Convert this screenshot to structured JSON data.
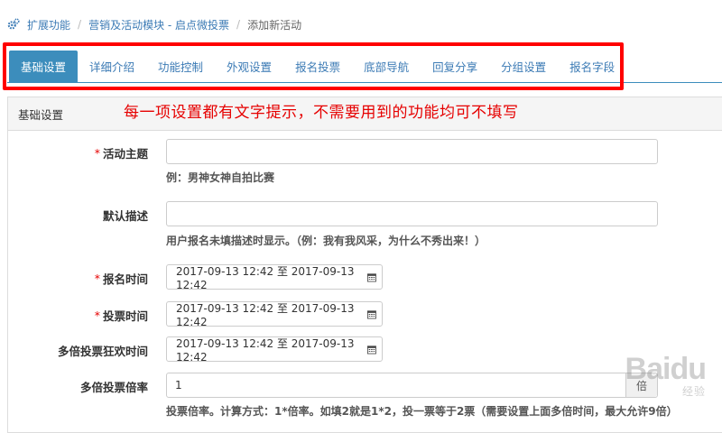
{
  "breadcrumb": {
    "items": [
      "扩展功能",
      "营销及活动模块 - 启点微投票",
      "添加新活动"
    ]
  },
  "tabs": [
    "基础设置",
    "详细介绍",
    "功能控制",
    "外观设置",
    "报名投票",
    "底部导航",
    "回复分享",
    "分组设置",
    "报名字段"
  ],
  "active_tab": "基础设置",
  "panel": {
    "title": "基础设置",
    "annotation": "每一项设置都有文字提示，不需要用到的功能均可不填写"
  },
  "form": {
    "theme": {
      "required": "*",
      "label": "活动主题",
      "value": "",
      "help": "例：男神女神自拍比赛"
    },
    "desc": {
      "label": "默认描述",
      "value": "",
      "help": "用户报名未填描述时显示。（例：我有我风采，为什么不秀出来！）"
    },
    "signup_time": {
      "required": "*",
      "label": "报名时间",
      "value": "2017-09-13 12:42 至 2017-09-13 12:42"
    },
    "vote_time": {
      "required": "*",
      "label": "投票时间",
      "value": "2017-09-13 12:42 至 2017-09-13 12:42"
    },
    "carnival_time": {
      "label": "多倍投票狂欢时间",
      "value": "2017-09-13 12:42 至 2017-09-13 12:42"
    },
    "multiplier": {
      "label": "多倍投票倍率",
      "value": "1",
      "unit": "倍",
      "help": "投票倍率。计算方式：1*倍率。如填2就是1*2，投一票等于2票（需要设置上面多倍时间，最大允许9倍）"
    }
  },
  "colors": {
    "accent": "#3c8dbc",
    "link": "#3c7bb5",
    "annotation": "#e60000"
  },
  "watermark": {
    "text": "Baidu",
    "sub": "经验"
  }
}
